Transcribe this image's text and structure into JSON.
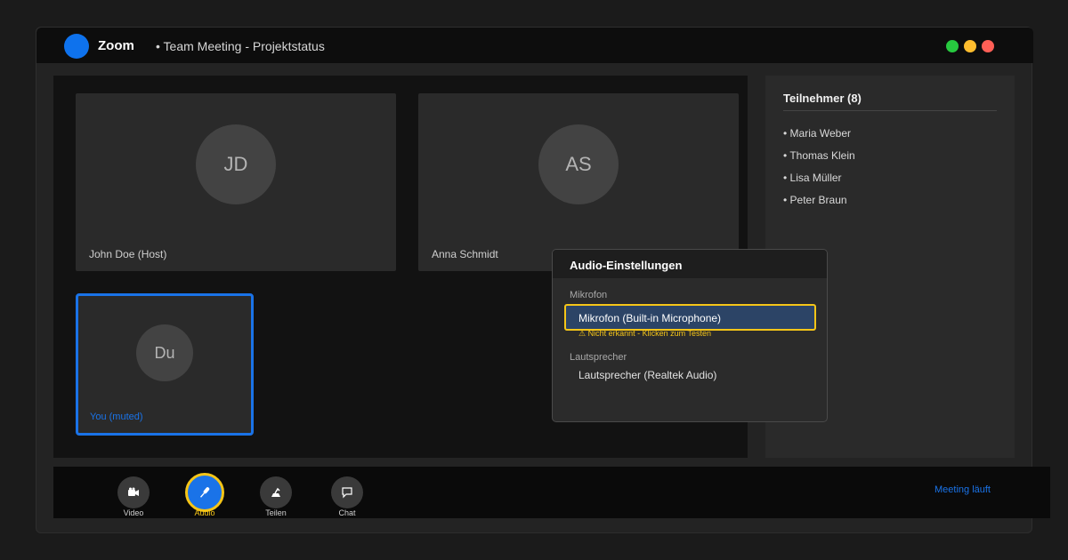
{
  "window": {
    "app_name": "Zoom",
    "meeting_title": "• Team Meeting - Projektstatus"
  },
  "colors": {
    "accent": "#1a73e8",
    "highlight": "#f5c518",
    "traffic_green": "#27c93f",
    "traffic_yellow": "#ffbd2e",
    "traffic_red": "#ff5f56"
  },
  "tiles": [
    {
      "initials": "JD",
      "name": "John Doe (Host)"
    },
    {
      "initials": "AS",
      "name": "Anna Schmidt"
    },
    {
      "initials": "Du",
      "name": "You (muted)"
    }
  ],
  "sidebar": {
    "title": "Teilnehmer (8)",
    "participants": [
      "• Maria Weber",
      "• Thomas Klein",
      "• Lisa Müller",
      "• Peter Braun"
    ]
  },
  "audio_settings": {
    "title": "Audio-Einstellungen",
    "mic_label": "Mikrofon",
    "mic_selected": "Mikrofon (Built-in Microphone)",
    "mic_warning": "⚠ Nicht erkannt - Klicken zum Testen",
    "speaker_label": "Lautsprecher",
    "speaker_selected": "Lautsprecher (Realtek Audio)"
  },
  "toolbar": {
    "items": [
      {
        "label": "Video",
        "icon": "video-camera-icon"
      },
      {
        "label": "Audio",
        "icon": "microphone-icon"
      },
      {
        "label": "Teilen",
        "icon": "share-icon"
      },
      {
        "label": "Chat",
        "icon": "chat-bubble-icon"
      }
    ],
    "status": "Meeting läuft"
  }
}
